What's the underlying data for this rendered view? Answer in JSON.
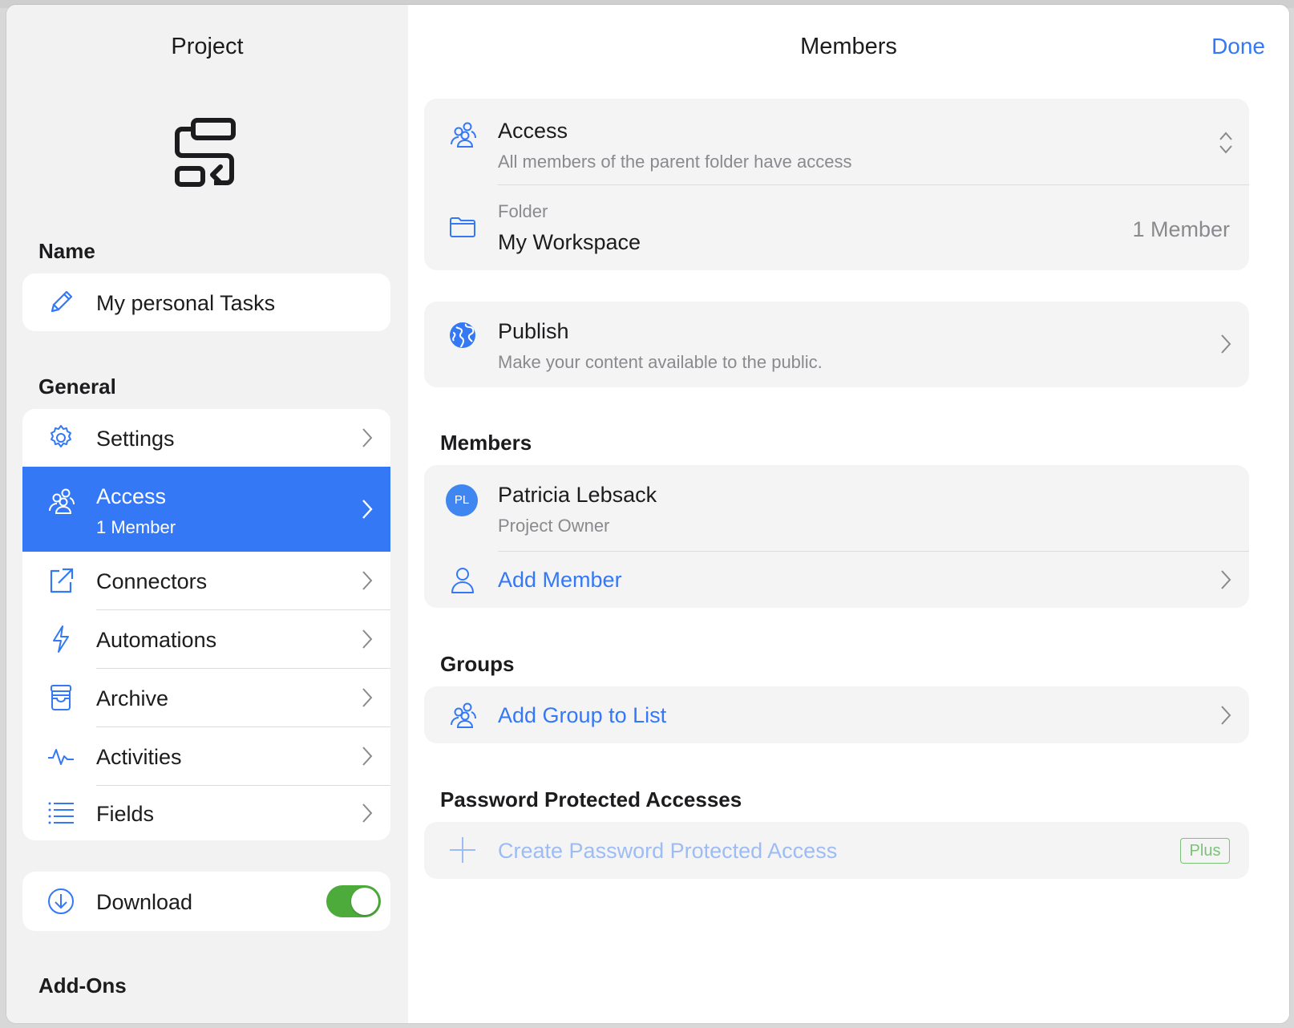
{
  "sidebar": {
    "title": "Project",
    "name_section": "Name",
    "project_name": "My personal Tasks",
    "general_section": "General",
    "items": [
      {
        "label": "Settings",
        "icon": "gear-icon"
      },
      {
        "label": "Access",
        "sub": "1 Member",
        "icon": "people-icon",
        "selected": true
      },
      {
        "label": "Connectors",
        "icon": "external-link-icon"
      },
      {
        "label": "Automations",
        "icon": "bolt-icon"
      },
      {
        "label": "Archive",
        "icon": "archive-box-icon"
      },
      {
        "label": "Activities",
        "icon": "pulse-icon"
      },
      {
        "label": "Fields",
        "icon": "list-icon"
      }
    ],
    "download_label": "Download",
    "download_enabled": true,
    "addons_section": "Add-Ons"
  },
  "main": {
    "title": "Members",
    "done_label": "Done",
    "access": {
      "label": "Access",
      "description": "All members of the parent folder have access",
      "folder_caption": "Folder",
      "folder_name": "My Workspace",
      "folder_members": "1 Member"
    },
    "publish": {
      "label": "Publish",
      "description": "Make your content available to the public."
    },
    "members_section": "Members",
    "members": [
      {
        "initials": "PL",
        "name": "Patricia Lebsack",
        "role": "Project Owner"
      }
    ],
    "add_member_label": "Add Member",
    "groups_section": "Groups",
    "add_group_label": "Add Group to List",
    "password_section": "Password Protected Accesses",
    "create_password_label": "Create Password Protected Access",
    "plus_badge": "Plus"
  },
  "colors": {
    "accent": "#3478f6",
    "toggle_on": "#4cab3b",
    "plus_badge": "#7cc07a"
  }
}
